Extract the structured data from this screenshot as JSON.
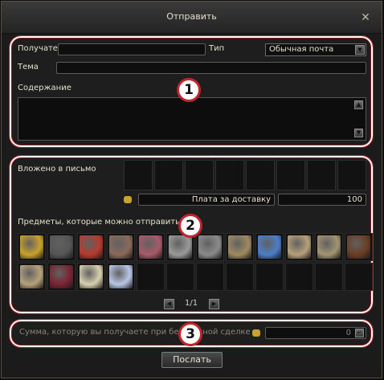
{
  "window": {
    "title": "Отправить",
    "close_glyph": "✕"
  },
  "compose": {
    "recipient_label": "Получатель",
    "type_label": "Тип",
    "type_value": "Обычная почта",
    "subject_label": "Тема",
    "content_label": "Содержание"
  },
  "attachments": {
    "label": "Вложено в письмо",
    "fee_label": "Плата за доставку",
    "fee_value": "100",
    "items_label": "Предметы, которые можно отправить",
    "page": "1/1",
    "items": [
      {
        "icon": "gold-ore-icon",
        "color": "#c9a22b"
      },
      {
        "icon": "dark-stone-icon",
        "color": "#555555"
      },
      {
        "icon": "red-potion-icon",
        "color": "#b73a2e"
      },
      {
        "icon": "flask-icon",
        "color": "#8a6a5a"
      },
      {
        "icon": "scroll-red-icon",
        "color": "#a85a6a"
      },
      {
        "icon": "sword-icon",
        "color": "#9a9a9a"
      },
      {
        "icon": "scroll-metal-icon",
        "color": "#8b8b8b"
      },
      {
        "icon": "recipe-icon",
        "color": "#a08a60"
      },
      {
        "icon": "blue-crystal-icon",
        "color": "#4a7ec8"
      },
      {
        "icon": "letter-icon",
        "color": "#b8a07a"
      },
      {
        "icon": "map-icon",
        "color": "#a39472"
      },
      {
        "icon": "lamp-icon",
        "color": "#6b3d24"
      },
      {
        "icon": "parchment-icon",
        "color": "#b7a17a"
      },
      {
        "icon": "dark-claw-icon",
        "color": "#7a2430"
      },
      {
        "icon": "orb-icon",
        "color": "#d8d0b0"
      },
      {
        "icon": "crystal-cluster-icon",
        "color": "#b9c6e6"
      }
    ]
  },
  "payment": {
    "label": "Сумма, которую вы получаете при безопасной сделке",
    "value": "0"
  },
  "buttons": {
    "send": "Послать"
  },
  "annotations": {
    "b1": "1",
    "b2": "2",
    "b3": "3"
  },
  "colors": {
    "highlight": "#c0242a",
    "panel": "#1e1e1e"
  }
}
